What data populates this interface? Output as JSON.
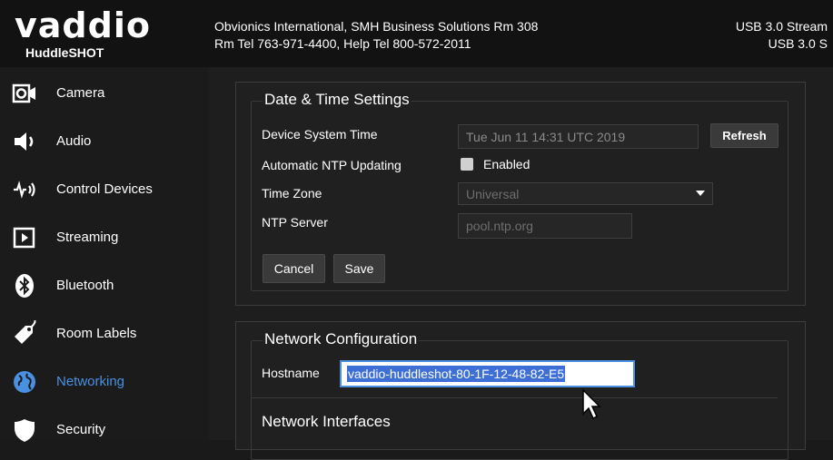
{
  "header": {
    "brand": "vaddio",
    "product": "HuddleSHOT",
    "info_line1": "Obvionics International, SMH Business Solutions Rm 308",
    "info_line2": "Rm Tel 763-971-4400, Help Tel 800-572-2011",
    "status_line1": "USB 3.0 Stream",
    "status_line2": "USB 3.0 S"
  },
  "sidebar": {
    "items": [
      {
        "label": "Camera",
        "icon": "camera-icon"
      },
      {
        "label": "Audio",
        "icon": "speaker-icon"
      },
      {
        "label": "Control Devices",
        "icon": "control-devices-icon"
      },
      {
        "label": "Streaming",
        "icon": "play-icon"
      },
      {
        "label": "Bluetooth",
        "icon": "bluetooth-icon"
      },
      {
        "label": "Room Labels",
        "icon": "tag-icon"
      },
      {
        "label": "Networking",
        "icon": "globe-icon",
        "active": true
      },
      {
        "label": "Security",
        "icon": "shield-icon"
      }
    ],
    "active_color": "#4a90e2"
  },
  "datetime": {
    "title": "Date & Time Settings",
    "device_time_label": "Device System Time",
    "device_time_value": "Tue Jun 11 14:31 UTC 2019",
    "refresh_label": "Refresh",
    "ntp_update_label": "Automatic NTP Updating",
    "ntp_enabled_label": "Enabled",
    "timezone_label": "Time Zone",
    "timezone_value": "Universal",
    "ntp_server_label": "NTP Server",
    "ntp_server_placeholder": "pool.ntp.org",
    "cancel_label": "Cancel",
    "save_label": "Save"
  },
  "network": {
    "title": "Network Configuration",
    "hostname_label": "Hostname",
    "hostname_value": "vaddio-huddleshot-80-1F-12-48-82-E5",
    "interfaces_title": "Network Interfaces"
  }
}
